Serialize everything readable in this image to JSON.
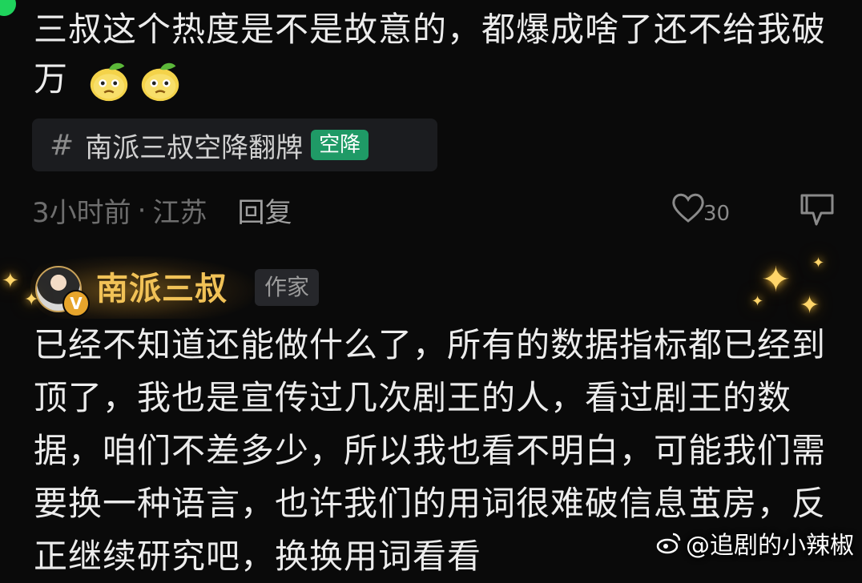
{
  "top_comment": {
    "text": "三叔这个热度是不是故意的，都爆成啥了还不给我破万",
    "topic_hash": "#",
    "topic": "南派三叔空降翻牌",
    "topic_badge": "空降",
    "time": "3小时前",
    "separator": "·",
    "location": "江苏",
    "reply_label": "回复",
    "like_count": "30",
    "emoji_icons": [
      "lemon-emoji",
      "lemon-emoji"
    ]
  },
  "reply": {
    "author": "南派三叔",
    "author_tag": "作家",
    "verified_badge": "V",
    "text": "已经不知道还能做什么了，所有的数据指标都已经到顶了，我也是宣传过几次剧王的人，看过剧王的数据，咱们不差多少，所以我也看不明白，可能我们需要换一种语言，也许我们的用词很难破信息茧房，反正继续研究吧，换换用词看看"
  },
  "watermark": {
    "text": "@追剧的小辣椒"
  },
  "colors": {
    "background": "#0a0a0a",
    "author_gold": "#f1c257",
    "badge_green": "#1f9a66",
    "verified_orange": "#e7a52c",
    "status_green": "#1fd35c"
  }
}
